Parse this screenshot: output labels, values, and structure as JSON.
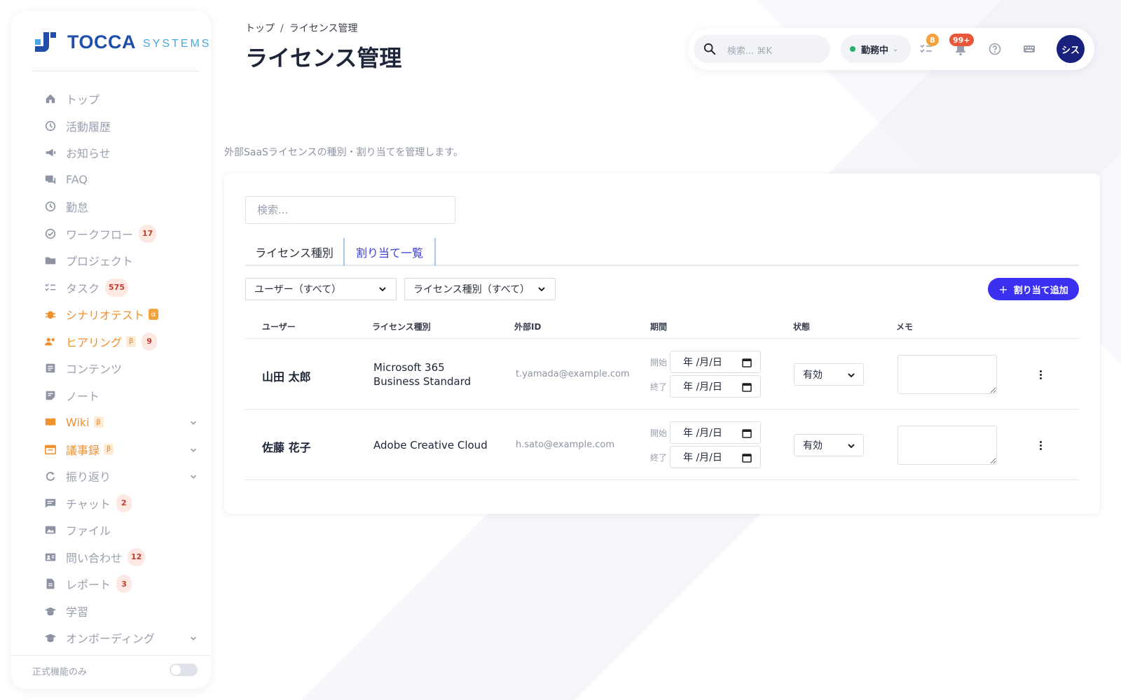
{
  "brand": {
    "name": "TOCCA",
    "sub": "SYSTEMS"
  },
  "sidebar": {
    "items": [
      {
        "label": "トップ",
        "icon": "home-icon"
      },
      {
        "label": "活動履歴",
        "icon": "history-icon"
      },
      {
        "label": "お知らせ",
        "icon": "megaphone-icon"
      },
      {
        "label": "FAQ",
        "icon": "chat-bubbles-icon"
      },
      {
        "label": "勤怠",
        "icon": "clock-icon"
      },
      {
        "label": "ワークフロー",
        "icon": "check-circle-icon",
        "count": "17"
      },
      {
        "label": "プロジェクト",
        "icon": "folder-icon"
      },
      {
        "label": "タスク",
        "icon": "checklist-icon",
        "count": "575"
      },
      {
        "label": "シナリオテスト",
        "icon": "bug-icon",
        "tag": "α",
        "accent": true
      },
      {
        "label": "ヒアリング",
        "icon": "people-icon",
        "tag": "β",
        "count": "9",
        "accent": true
      },
      {
        "label": "コンテンツ",
        "icon": "article-icon"
      },
      {
        "label": "ノート",
        "icon": "note-icon"
      },
      {
        "label": "Wiki",
        "icon": "book-icon",
        "tag": "β",
        "accent": true,
        "expandable": true
      },
      {
        "label": "議事録",
        "icon": "calendar-icon",
        "tag": "β",
        "accent": true,
        "expandable": true
      },
      {
        "label": "振り返り",
        "icon": "refresh-icon",
        "expandable": true
      },
      {
        "label": "チャット",
        "icon": "chat-icon",
        "count": "2"
      },
      {
        "label": "ファイル",
        "icon": "images-icon"
      },
      {
        "label": "問い合わせ",
        "icon": "contact-card-icon",
        "count": "12"
      },
      {
        "label": "レポート",
        "icon": "document-icon",
        "count": "3"
      },
      {
        "label": "学習",
        "icon": "graduation-cap-icon"
      },
      {
        "label": "オンボーディング",
        "icon": "graduation-cap-icon",
        "expandable": true
      }
    ],
    "footer_label": "正式機能のみ"
  },
  "header": {
    "breadcrumb": [
      "トップ",
      "ライセンス管理"
    ],
    "title": "ライセンス管理"
  },
  "topbar": {
    "search_placeholder": "検索... ⌘K",
    "status": "勤務中",
    "tasks_badge": "8",
    "notifications_badge": "99+",
    "avatar": "シス"
  },
  "description": "外部SaaSライセンスの種別・割り当てを管理します。",
  "main": {
    "search_placeholder": "検索...",
    "tabs": [
      "ライセンス種別",
      "割り当て一覧"
    ],
    "filters": {
      "user": "ユーザー（すべて）",
      "license_type": "ライセンス種別（すべて）"
    },
    "add_button": "割り当て追加",
    "columns": [
      "ユーザー",
      "ライセンス種別",
      "外部ID",
      "期間",
      "状態",
      "メモ"
    ],
    "period_labels": {
      "start": "開始",
      "end": "終了"
    },
    "date_placeholder": "年 /月/日",
    "rows": [
      {
        "user": "山田 太郎",
        "license_type": [
          "Microsoft 365",
          "Business Standard"
        ],
        "external_id": "t.yamada@example.com",
        "status": "有効"
      },
      {
        "user": "佐藤 花子",
        "license_type": [
          "Adobe Creative Cloud"
        ],
        "external_id": "h.sato@example.com",
        "status": "有効"
      }
    ]
  },
  "colors": {
    "accent": "#3b2ff0",
    "orange": "#f0902e",
    "avatar_bg": "#17207a"
  }
}
